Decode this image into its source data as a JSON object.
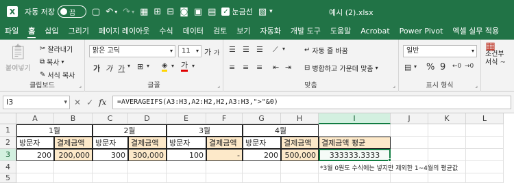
{
  "titlebar": {
    "logo": "X",
    "autosave_label": "자동 저장",
    "autosave_state": "끔",
    "gridlines_label": "눈금선",
    "filename": "예시 (2).xlsx",
    "icons": [
      "save-icon",
      "undo-icon",
      "redo-icon",
      "grid-icon",
      "camera-icon",
      "format-cells-icon",
      "filter-icon",
      "paste-values-icon",
      "conditional-icon",
      "more-icon"
    ]
  },
  "menu": {
    "tabs": [
      "파일",
      "홈",
      "삽입",
      "그리기",
      "페이지 레이아웃",
      "수식",
      "데이터",
      "검토",
      "보기",
      "자동화",
      "개발 도구",
      "도움말",
      "Acrobat",
      "Power Pivot",
      "엑셀 실무 적용"
    ],
    "active_index": 1
  },
  "ribbon": {
    "clipboard": {
      "paste": "붙여넣기",
      "cut": "잘라내기",
      "copy": "복사",
      "format_painter": "서식 복사",
      "label": "클립보드"
    },
    "font": {
      "font_name": "맑은 고딕",
      "font_size": "11",
      "bold": "가",
      "italic": "가",
      "underline": "가",
      "grow": "가",
      "shrink": "가",
      "font_color_glyph": "가",
      "label": "글꼴"
    },
    "alignment": {
      "wrap_text": "자동 줄 바꿈",
      "merge_center": "병합하고 가운데 맞춤",
      "label": "맞춤"
    },
    "number": {
      "format": "일반",
      "percent": "%",
      "comma": "9",
      "label": "표시 형식"
    },
    "styles": {
      "conditional_1": "조건부",
      "conditional_2": "서식 ~"
    }
  },
  "formula_bar": {
    "name_box": "I3",
    "fx": "fx",
    "formula": "=AVERAGEIFS(A3:H3,A2:H2,H2,A3:H3,\">\"&0)"
  },
  "accent": "#217346",
  "sheet": {
    "columns": [
      "A",
      "B",
      "C",
      "D",
      "E",
      "F",
      "G",
      "H",
      "I",
      "J",
      "K",
      "L"
    ],
    "rows": [
      "1",
      "2",
      "3",
      "4",
      "5"
    ],
    "months": [
      "1월",
      "2월",
      "3월",
      "4월"
    ],
    "row2": [
      "방문자",
      "결제금액",
      "방문자",
      "결제금액",
      "방문자",
      "결제금액",
      "방문자",
      "결제금액",
      "결제금액 평균"
    ],
    "row3": [
      "200",
      "200,000",
      "300",
      "300,000",
      "100",
      "-",
      "200",
      "500,000",
      "333333.3333"
    ],
    "note": "*3월 0원도 수식에는 넣지만 제외한 1~4월의 평균값"
  }
}
